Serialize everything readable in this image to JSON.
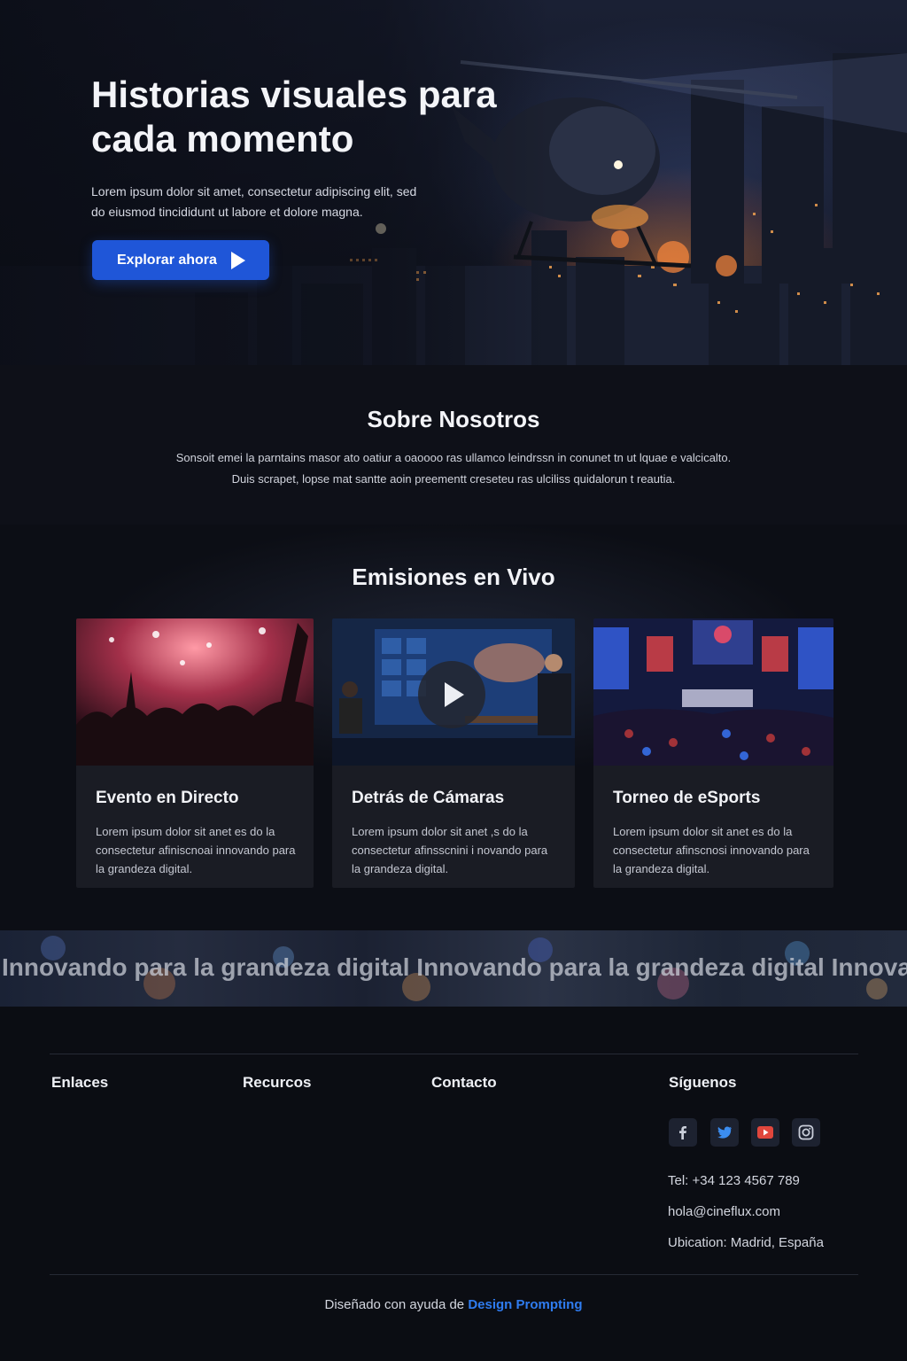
{
  "hero": {
    "title": "Historias visuales para cada momento",
    "subtitle": "Lorem ipsum dolor sit amet, consectetur adipiscing elit, sed do eiusmod tincididunt ut labore et dolore magna.",
    "cta_label": "Explorar ahora",
    "cta_icon": "play-arrow-icon"
  },
  "about": {
    "title": "Sobre Nosotros",
    "line1": "Sonsoit emei la parntains masor ato oatiur a oaoooo ras ullamco leindrssn in conunet tn ut lquae e valcicalto.",
    "line2": "Duis scrapet, lopse mat santte aoin preementt creseteu ras ulciliss quidalorun t reautia."
  },
  "live": {
    "title": "Emisiones en Vivo",
    "cards": [
      {
        "title": "Evento en Directo",
        "description": "Lorem ipsum dolor sit anet es do la consectetur afiniscnoai innovando para la grandeza digital.",
        "image": "concert-crowd"
      },
      {
        "title": "Detrás de Cámaras",
        "description": "Lorem ipsum dolor sit anet ,s do la consectetur afinsscnini i novando para la grandeza digital.",
        "image": "tv-studio",
        "play_icon": "play-circle-icon"
      },
      {
        "title": "Torneo de eSports",
        "description": "Lorem ipsum dolor sit anet es do la consectetur afinscnosi innovando para la grandeza digital.",
        "image": "esports-arena"
      }
    ]
  },
  "marquee": {
    "text": "Innovando para la grandeza digital Innovando para la grandeza digital Innovando para la grandeza digital"
  },
  "footer": {
    "columns": [
      "Enlaces",
      "Recurcos",
      "Contacto",
      "Síguenos"
    ],
    "social": [
      {
        "icon": "facebook-icon",
        "glyph": "f",
        "color": "#c9ced9"
      },
      {
        "icon": "twitter-icon",
        "glyph": "🐦",
        "color": "#3b8df0"
      },
      {
        "icon": "youtube-icon",
        "glyph": "▶",
        "color": "#e0463c"
      },
      {
        "icon": "instagram-icon",
        "glyph": "◎",
        "color": "#c9ced9"
      }
    ],
    "phone": "Tel: +34 123 4567 789",
    "email": "hola@cineflux.com",
    "location": "Ubication: Madrid, España",
    "credit_prefix": "Diseñado con ayuda de ",
    "credit_link": "Design Prompting"
  },
  "colors": {
    "accent": "#1f56d8",
    "link": "#2f7cf0",
    "background": "#0b0d13"
  }
}
